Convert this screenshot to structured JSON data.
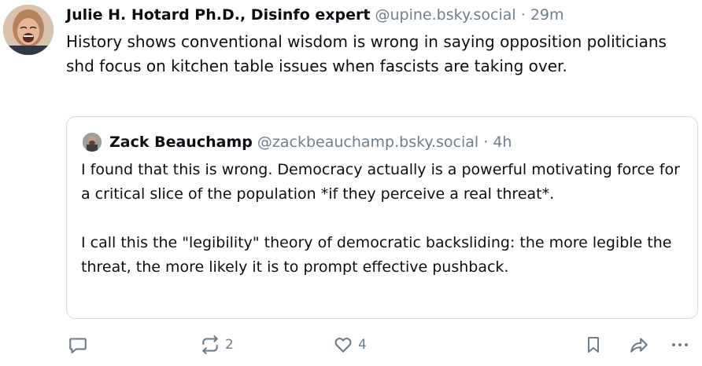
{
  "post": {
    "author_name": "Julie H. Hotard Ph.D., Disinfo expert",
    "author_handle": "@upine.bsky.social",
    "separator": "·",
    "time": "29m",
    "text": "History shows conventional wisdom is wrong in saying opposition politicians shd focus on kitchen table issues when fascists are taking over."
  },
  "quote": {
    "author_name": "Zack Beauchamp",
    "author_handle": "@zackbeauchamp.bsky.social",
    "separator": "·",
    "time": "4h",
    "paragraphs": [
      "I found that this is wrong. Democracy actually is a powerful motivating force for a critical slice of the population *if they perceive a real threat*.",
      "I call this the \"legibility\" theory of democratic backsliding: the more legible the threat, the more likely it is to prompt effective pushback."
    ]
  },
  "actions": {
    "reply_icon": "speech-bubble-icon",
    "repost_icon": "repost-arrows-icon",
    "repost_count": "2",
    "like_icon": "heart-icon",
    "like_count": "4",
    "bookmark_icon": "bookmark-icon",
    "share_icon": "share-arrow-icon",
    "more_icon": "ellipsis-icon"
  },
  "colors": {
    "text": "#0b0f14",
    "muted": "#6f7e8c",
    "border": "#d4dbe2"
  }
}
